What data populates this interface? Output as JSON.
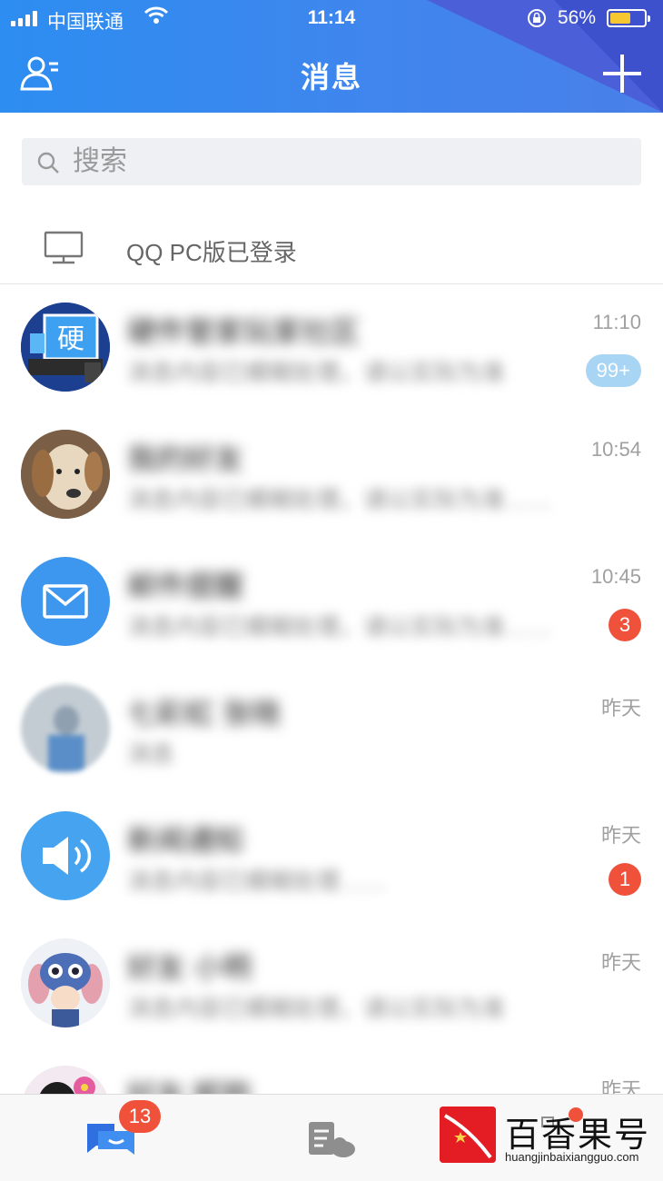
{
  "status_bar": {
    "carrier": "中国联通",
    "time": "11:14",
    "battery": "56%"
  },
  "nav": {
    "title": "消息"
  },
  "search": {
    "placeholder": "搜索"
  },
  "pc_login": {
    "text": "QQ PC版已登录"
  },
  "conversations": [
    {
      "name": "硬件管家玩家社区",
      "preview": "消息内容已模糊处理，请以实际为准",
      "time": "11:10",
      "badge": "99+",
      "badge_style": "muted",
      "avatar": "computer-avatar"
    },
    {
      "name": "我的好友",
      "preview": "消息内容已模糊处理，请以实际为准……",
      "time": "10:54",
      "badge": "",
      "avatar": "dog-avatar"
    },
    {
      "name": "邮件提醒",
      "preview": "消息内容已模糊处理，请以实际为准……",
      "time": "10:45",
      "badge": "3",
      "badge_style": "red",
      "avatar": "mail-avatar"
    },
    {
      "name": "七彩虹 张晓",
      "preview": "消息",
      "time": "昨天",
      "badge": "",
      "avatar": "photo-avatar"
    },
    {
      "name": "新闻通知",
      "preview": "消息内容已模糊处理……",
      "time": "昨天",
      "badge": "1",
      "badge_style": "red",
      "avatar": "speaker-avatar"
    },
    {
      "name": "好友 小明",
      "preview": "消息内容已模糊处理，请以实际为准",
      "time": "昨天",
      "badge": "",
      "avatar": "cartoon-avatar"
    },
    {
      "name": "好友 昵称",
      "preview": "",
      "time": "昨天",
      "badge": "",
      "avatar": "penguin-avatar"
    }
  ],
  "tabbar": {
    "messages_badge": "13"
  },
  "watermark": {
    "title": "百香果号",
    "url": "huangjinbaixiangguo.com"
  },
  "colors": {
    "header_blue": "#2d8df0",
    "badge_red": "#f0513b",
    "badge_muted": "#a9d5f4",
    "mail_avatar_blue": "#3d97ee"
  }
}
